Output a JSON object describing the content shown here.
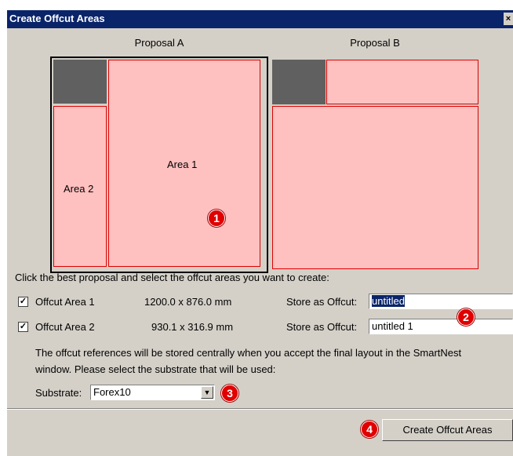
{
  "window": {
    "title": "Create Offcut Areas",
    "close_glyph": "×"
  },
  "proposals": {
    "a_label": "Proposal A",
    "b_label": "Proposal B",
    "area1_label": "Area 1",
    "area2_label": "Area 2"
  },
  "instruction": "Click the best proposal and select the offcut areas you want to create:",
  "offcuts": [
    {
      "checked": true,
      "check_glyph": "✓",
      "label": "Offcut Area 1",
      "size": "1200.0 x  876.0 mm",
      "store_label": "Store as Offcut:",
      "value": "untitled"
    },
    {
      "checked": true,
      "check_glyph": "✓",
      "label": "Offcut Area 2",
      "size": "930.1 x  316.9 mm",
      "store_label": "Store as Offcut:",
      "value": "untitled 1"
    }
  ],
  "note_line1": "The offcut references will be stored centrally when you accept the final layout in the SmartNest",
  "note_line2": "window. Please select the substrate that will be used:",
  "substrate": {
    "label": "Substrate:",
    "value": "Forex10",
    "dropdown_glyph": "▼"
  },
  "create_button": "Create Offcut Areas",
  "badges": [
    "1",
    "2",
    "3",
    "4"
  ],
  "colors": {
    "titlebar": "#0a246a",
    "area_fill": "#ffc0c0",
    "area_border": "#e00000",
    "badge": "#e00000",
    "dialog_bg": "#d4d0c8"
  }
}
